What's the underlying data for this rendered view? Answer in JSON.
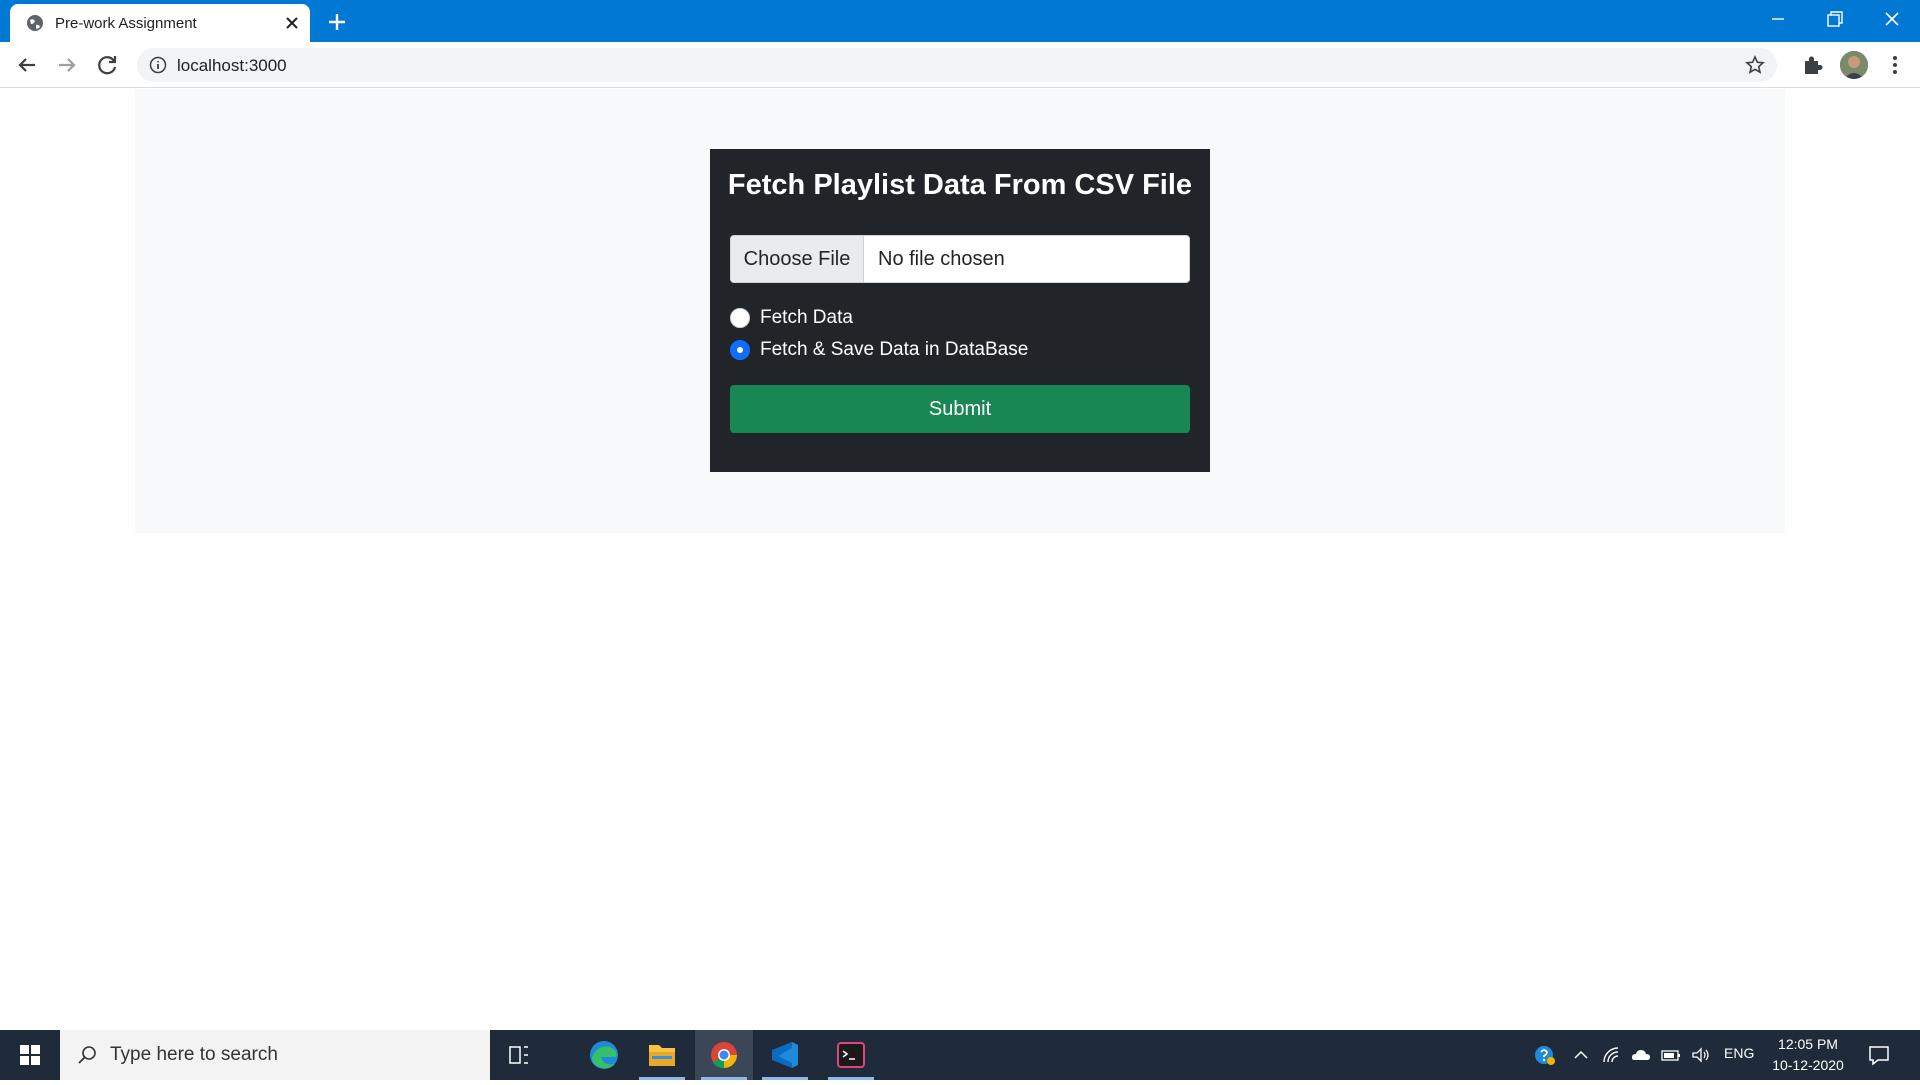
{
  "browser": {
    "tab_title": "Pre-work Assignment",
    "url": "localhost:3000"
  },
  "form": {
    "title": "Fetch Playlist Data From CSV File",
    "file_button_label": "Choose File",
    "file_status": "No file chosen",
    "options": [
      {
        "label": "Fetch Data",
        "checked": false
      },
      {
        "label": "Fetch & Save Data in DataBase",
        "checked": true
      }
    ],
    "submit_label": "Submit"
  },
  "taskbar": {
    "search_placeholder": "Type here to search",
    "language": "ENG",
    "time": "12:05 PM",
    "date": "10-12-2020"
  },
  "colors": {
    "titlebar": "#0078d4",
    "card_bg": "#212529",
    "submit_bg": "#198754",
    "radio_checked": "#0d6efd",
    "container_bg": "#f8f9fa"
  }
}
